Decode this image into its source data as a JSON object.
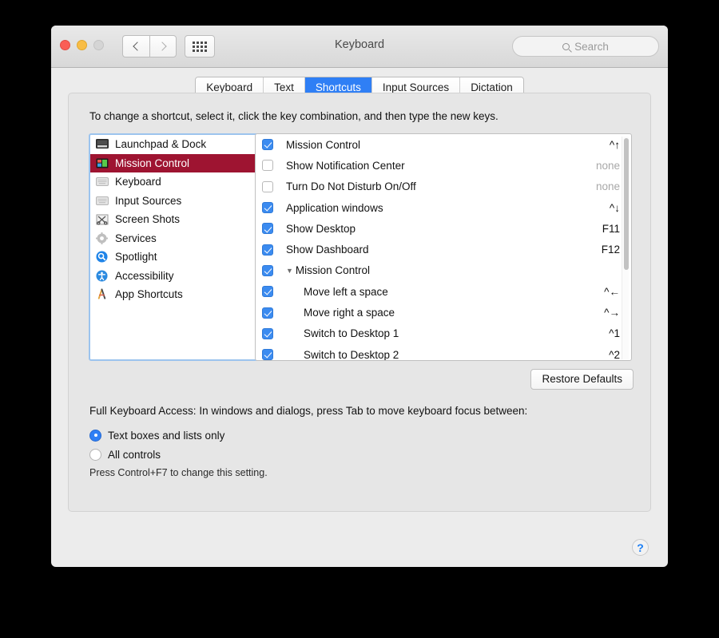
{
  "window": {
    "title": "Keyboard",
    "traffic_lights": [
      "close-red",
      "minimize-yellow",
      "zoom-gray"
    ],
    "nav_back": "back-chevron",
    "nav_forward": "forward-chevron",
    "grid_button": "show-all-grid"
  },
  "search": {
    "placeholder": "Search",
    "icon": "search-icon"
  },
  "tabs": [
    {
      "label": "Keyboard",
      "active": false
    },
    {
      "label": "Text",
      "active": false
    },
    {
      "label": "Shortcuts",
      "active": true
    },
    {
      "label": "Input Sources",
      "active": false
    },
    {
      "label": "Dictation",
      "active": false
    }
  ],
  "instruction": "To change a shortcut, select it, click the key combination, and then type the new keys.",
  "sidebar": {
    "items": [
      {
        "label": "Launchpad & Dock",
        "icon": "launchpad-dock-icon",
        "selected": false
      },
      {
        "label": "Mission Control",
        "icon": "mission-control-icon",
        "selected": true
      },
      {
        "label": "Keyboard",
        "icon": "keyboard-icon",
        "selected": false
      },
      {
        "label": "Input Sources",
        "icon": "input-sources-icon",
        "selected": false
      },
      {
        "label": "Screen Shots",
        "icon": "screenshots-icon",
        "selected": false
      },
      {
        "label": "Services",
        "icon": "services-gear-icon",
        "selected": false
      },
      {
        "label": "Spotlight",
        "icon": "spotlight-icon",
        "selected": false
      },
      {
        "label": "Accessibility",
        "icon": "accessibility-icon",
        "selected": false
      },
      {
        "label": "App Shortcuts",
        "icon": "app-shortcuts-icon",
        "selected": false
      }
    ],
    "selection_color": "#9e1431"
  },
  "shortcut_list": {
    "rows": [
      {
        "label": "Mission Control",
        "combo": "^↑",
        "checked": true,
        "indent": 0,
        "group": false,
        "none": false
      },
      {
        "label": "Show Notification Center",
        "combo": "none",
        "checked": false,
        "indent": 0,
        "group": false,
        "none": true
      },
      {
        "label": "Turn Do Not Disturb On/Off",
        "combo": "none",
        "checked": false,
        "indent": 0,
        "group": false,
        "none": true
      },
      {
        "label": "Application windows",
        "combo": "^↓",
        "checked": true,
        "indent": 0,
        "group": false,
        "none": false
      },
      {
        "label": "Show Desktop",
        "combo": "F11",
        "checked": true,
        "indent": 0,
        "group": false,
        "none": false
      },
      {
        "label": "Show Dashboard",
        "combo": "F12",
        "checked": true,
        "indent": 0,
        "group": false,
        "none": false
      },
      {
        "label": "Mission Control",
        "combo": "",
        "checked": true,
        "indent": 0,
        "group": true,
        "none": false
      },
      {
        "label": "Move left a space",
        "combo": "^←",
        "checked": true,
        "indent": 1,
        "group": false,
        "none": false
      },
      {
        "label": "Move right a space",
        "combo": "^→",
        "checked": true,
        "indent": 1,
        "group": false,
        "none": false
      },
      {
        "label": "Switch to Desktop 1",
        "combo": "^1",
        "checked": true,
        "indent": 1,
        "group": false,
        "none": false
      },
      {
        "label": "Switch to Desktop 2",
        "combo": "^2",
        "checked": true,
        "indent": 1,
        "group": false,
        "none": false
      }
    ],
    "disclosure_glyph": "▼",
    "checkbox_color": "#3b8bf0"
  },
  "restore_defaults": {
    "label": "Restore Defaults"
  },
  "full_keyboard_access": {
    "description": "Full Keyboard Access: In windows and dialogs, press Tab to move keyboard focus between:",
    "options": [
      {
        "label": "Text boxes and lists only",
        "selected": true
      },
      {
        "label": "All controls",
        "selected": false
      }
    ],
    "hint": "Press Control+F7 to change this setting."
  },
  "help_button": {
    "glyph": "?"
  }
}
